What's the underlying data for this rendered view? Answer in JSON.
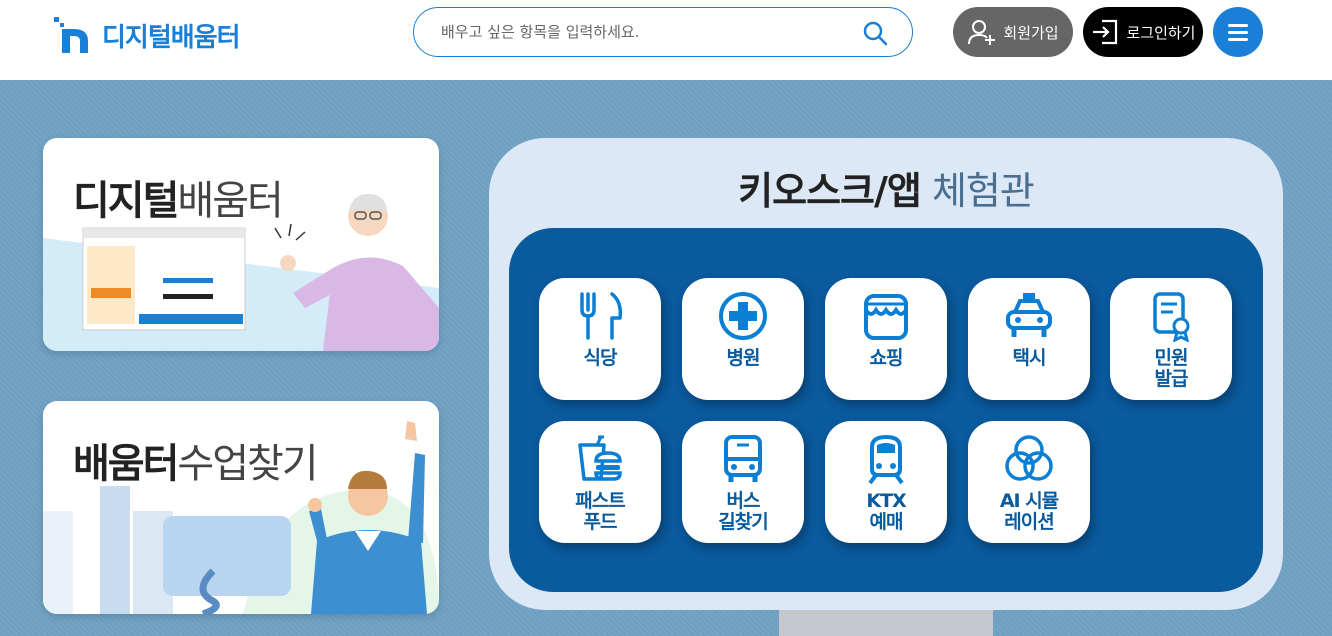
{
  "header": {
    "logo_text": "디지털배움터",
    "search_placeholder": "배우고 싶은 항목을 입력하세요.",
    "signup_label": "회원가입",
    "login_label": "로그인하기"
  },
  "cards": [
    {
      "title_bold": "디지털",
      "title_light": "배움터"
    },
    {
      "title_bold": "배움터",
      "title_light": "수업찾기"
    }
  ],
  "kiosk": {
    "title_bold": "키오스크/앱",
    "title_light": "체험관",
    "tiles": [
      {
        "label": "식당",
        "icon": "utensils-icon"
      },
      {
        "label": "병원",
        "icon": "hospital-cross-icon"
      },
      {
        "label": "쇼핑",
        "icon": "shop-icon"
      },
      {
        "label": "택시",
        "icon": "taxi-icon"
      },
      {
        "label": "민원\n발급",
        "icon": "certificate-icon"
      },
      {
        "label": "패스트\n푸드",
        "icon": "fastfood-icon"
      },
      {
        "label": "버스\n길찾기",
        "icon": "bus-icon"
      },
      {
        "label": "KTX\n예매",
        "icon": "train-icon"
      },
      {
        "label": "AI 시뮬\n레이션",
        "icon": "ai-circles-icon"
      }
    ]
  },
  "colors": {
    "brand": "#1a7fd6",
    "kiosk_screen": "#0a5a9e",
    "background": "#6e9fc2"
  }
}
